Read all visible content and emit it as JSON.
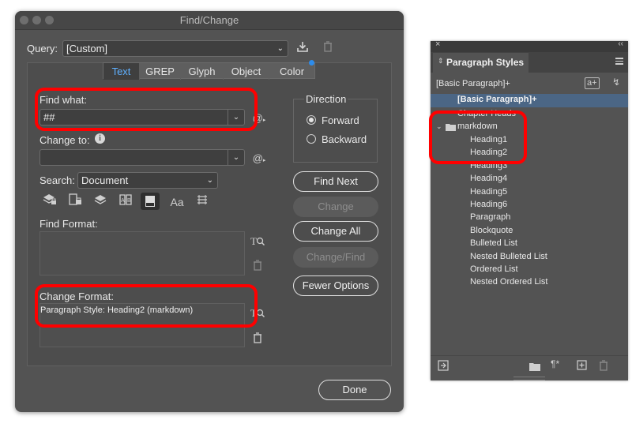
{
  "dialog": {
    "title": "Find/Change",
    "query_label": "Query:",
    "query_value": "[Custom]",
    "tabs": [
      {
        "label": "Text",
        "selected": true
      },
      {
        "label": "GREP",
        "selected": false
      },
      {
        "label": "Glyph",
        "selected": false
      },
      {
        "label": "Object",
        "selected": false
      },
      {
        "label": "Color",
        "selected": false
      }
    ],
    "find_what_label": "Find what:",
    "find_what_value": "##",
    "change_to_label": "Change to:",
    "change_to_value": "",
    "search_label": "Search:",
    "search_value": "Document",
    "find_format_label": "Find Format:",
    "change_format_label": "Change Format:",
    "change_format_value": "Paragraph Style: Heading2 (markdown)",
    "direction_label": "Direction",
    "direction_options": [
      "Forward",
      "Backward"
    ],
    "direction_selected": "Forward",
    "buttons": {
      "find_next": "Find Next",
      "change": "Change",
      "change_all": "Change All",
      "change_find": "Change/Find",
      "fewer_options": "Fewer Options",
      "done": "Done"
    },
    "icons": {
      "special_char": "@",
      "info": "i",
      "case_sensitive": "Aa"
    }
  },
  "paragraph_styles": {
    "title": "Paragraph Styles",
    "current_style": "[Basic Paragraph]+",
    "selected_row": "[Basic Paragraph]+",
    "partial_row": "Chapter Heads",
    "group_name": "markdown",
    "styles": [
      "Heading1",
      "Heading2",
      "Heading3",
      "Heading4",
      "Heading5",
      "Heading6",
      "Paragraph",
      "Blockquote",
      "Bulleted List",
      "Nested Bulleted List",
      "Ordered List",
      "Nested Ordered List"
    ]
  },
  "colors": {
    "highlight": "#ff0000",
    "selection": "#4b6685",
    "dialog_bg": "#535353"
  }
}
